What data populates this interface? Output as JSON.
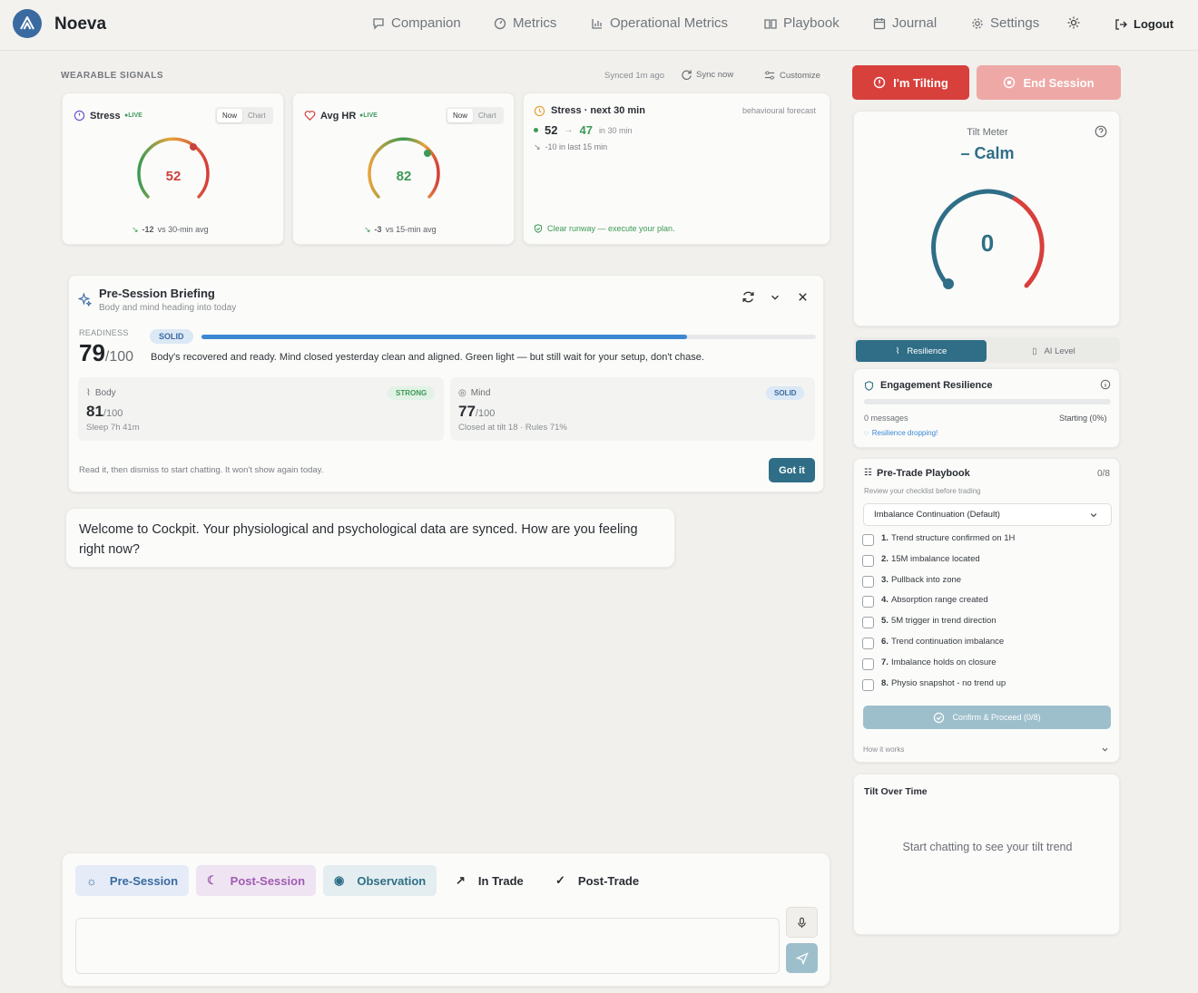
{
  "app": {
    "name": "Noeva"
  },
  "nav": {
    "companion": "Companion",
    "metrics": "Metrics",
    "operational": "Operational Metrics",
    "playbook": "Playbook",
    "journal": "Journal",
    "settings": "Settings",
    "logout": "Logout"
  },
  "signals": {
    "title": "WEARABLE SIGNALS",
    "synced": "Synced 1m ago",
    "sync_now": "Sync now",
    "customize": "Customize"
  },
  "stress": {
    "label": "Stress",
    "live": "●LIVE",
    "now": "Now",
    "chart": "Chart",
    "value": "52",
    "delta": "-12",
    "delta_note": "vs 30-min avg",
    "color": "#c9423e"
  },
  "hr": {
    "label": "Avg HR",
    "live": "●LIVE",
    "now": "Now",
    "chart": "Chart",
    "value": "82",
    "delta": "-3",
    "delta_note": "vs 15-min avg",
    "color": "#3d9a55"
  },
  "forecast": {
    "title": "Stress · next 30 min",
    "tag": "behavioural forecast",
    "from": "52",
    "to": "47",
    "in": "in 30 min",
    "trend": "-10 in last 15 min",
    "note": "Clear runway — execute your plan."
  },
  "briefing": {
    "title": "Pre-Session Briefing",
    "subtitle": "Body and mind heading into today",
    "readiness_label": "READINESS",
    "badge": "SOLID",
    "score": "79",
    "max": "/100",
    "readiness_progress": 0.79,
    "summary": "Body's recovered and ready. Mind closed yesterday clean and aligned. Green light — but still wait for your setup, don't chase.",
    "body": {
      "label": "Body",
      "badge": "STRONG",
      "score": "81",
      "max": "/100",
      "detail": "Sleep 7h 41m"
    },
    "mind": {
      "label": "Mind",
      "badge": "SOLID",
      "score": "77",
      "max": "/100",
      "detail": "Closed at tilt 18 · Rules 71%"
    },
    "footer": "Read it, then dismiss to start chatting. It won't show again today.",
    "got_it": "Got it"
  },
  "chat": {
    "welcome": "Welcome to Cockpit. Your physiological and psychological data are synced. How are you feeling right now?",
    "input_placeholder": ""
  },
  "phases": {
    "pre": "Pre-Session",
    "post": "Post-Session",
    "obs": "Observation",
    "in": "In Trade",
    "posttrade": "Post-Trade"
  },
  "actions": {
    "tilting": "I'm Tilting",
    "end": "End Session"
  },
  "tilt": {
    "title": "Tilt Meter",
    "state": "Calm",
    "value": "0"
  },
  "tabs": {
    "resilience": "Resilience",
    "ai": "AI Level"
  },
  "engagement": {
    "title": "Engagement Resilience",
    "messages": "0 messages",
    "starting": "Starting (0%)",
    "progress": 0,
    "warning": "Resilience dropping!"
  },
  "playbook": {
    "title": "Pre-Trade Playbook",
    "count": "0/8",
    "subtitle": "Review your checklist before trading",
    "select": "Imbalance Continuation (Default)",
    "items": [
      {
        "n": "1.",
        "t": "Trend structure confirmed on 1H"
      },
      {
        "n": "2.",
        "t": "15M imbalance located"
      },
      {
        "n": "3.",
        "t": "Pullback into zone"
      },
      {
        "n": "4.",
        "t": "Absorption range created"
      },
      {
        "n": "5.",
        "t": "5M trigger in trend direction"
      },
      {
        "n": "6.",
        "t": "Trend continuation imbalance"
      },
      {
        "n": "7.",
        "t": "Imbalance holds on closure"
      },
      {
        "n": "8.",
        "t": "Physio snapshot - no trend up"
      }
    ],
    "confirm": "Confirm & Proceed (0/8)",
    "how": "How it works"
  },
  "tilt_time": {
    "title": "Tilt Over Time",
    "empty": "Start chatting to see your tilt trend"
  },
  "colors": {
    "teal": "#2f6e86",
    "red": "#d8403c",
    "green": "#3d9a55"
  }
}
